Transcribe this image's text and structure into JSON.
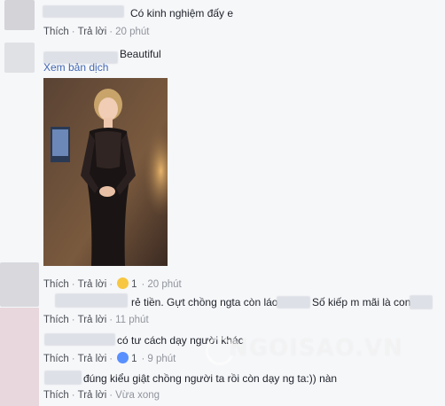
{
  "actions": {
    "like": "Thích",
    "reply": "Trả lời"
  },
  "comments": [
    {
      "text": "Có kinh nghiệm đấy e",
      "time": "20 phút"
    },
    {
      "text": "Beautiful",
      "translate": "Xem bản dịch",
      "reaction_count": "1",
      "time": "20 phút"
    },
    {
      "text_a": "rẻ tiền. Gựt chồng ngta còn láo",
      "text_b": "Số kiếp m mãi là con",
      "time": "11 phút"
    },
    {
      "text": "có tư cách dạy người khác",
      "reaction_count": "1",
      "time": "9 phút"
    },
    {
      "text": "đúng kiểu giật chồng người ta rồi còn dạy ng ta:)) nàn",
      "time": "Vừa xong"
    }
  ],
  "watermark": "NGOISAO.VN",
  "colors": {
    "link": "#4267b2",
    "meta": "#90949c",
    "background": "#f6f7f9"
  }
}
